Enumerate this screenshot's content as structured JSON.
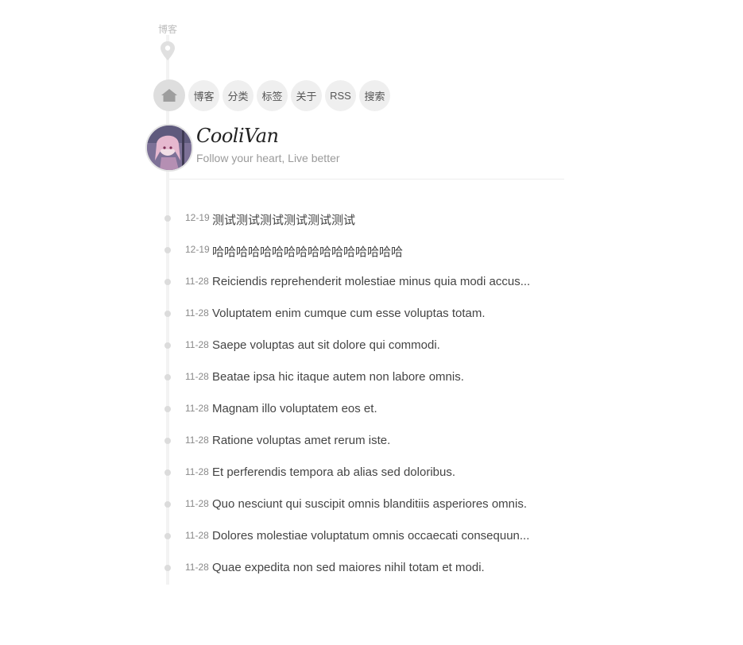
{
  "header": {
    "site_label": "博客",
    "title": "CooliVan",
    "subtitle": "Follow your heart, Live better"
  },
  "icons": {
    "location": "location-pin-icon",
    "home": "home-icon"
  },
  "nav": {
    "items": [
      {
        "label": "博客"
      },
      {
        "label": "分类"
      },
      {
        "label": "标签"
      },
      {
        "label": "关于"
      },
      {
        "label": "RSS"
      },
      {
        "label": "搜索"
      }
    ]
  },
  "posts": [
    {
      "date": "12-19",
      "title": "测试测试测试测试测试测试"
    },
    {
      "date": "12-19",
      "title": "哈哈哈哈哈哈哈哈哈哈哈哈哈哈哈哈"
    },
    {
      "date": "11-28",
      "title": "Reiciendis reprehenderit molestiae minus quia modi accus..."
    },
    {
      "date": "11-28",
      "title": "Voluptatem enim cumque cum esse voluptas totam."
    },
    {
      "date": "11-28",
      "title": "Saepe voluptas aut sit dolore qui commodi."
    },
    {
      "date": "11-28",
      "title": "Beatae ipsa hic itaque autem non labore omnis."
    },
    {
      "date": "11-28",
      "title": "Magnam illo voluptatem eos et."
    },
    {
      "date": "11-28",
      "title": "Ratione voluptas amet rerum iste."
    },
    {
      "date": "11-28",
      "title": "Et perferendis tempora ab alias sed doloribus."
    },
    {
      "date": "11-28",
      "title": "Quo nesciunt qui suscipit omnis blanditiis asperiores omnis."
    },
    {
      "date": "11-28",
      "title": "Dolores molestiae voluptatum omnis occaecati consequun..."
    },
    {
      "date": "11-28",
      "title": "Quae expedita non sed maiores nihil totam et modi."
    }
  ]
}
